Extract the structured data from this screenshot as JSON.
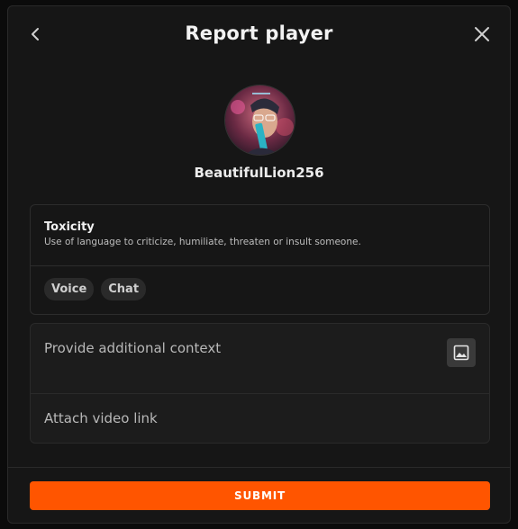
{
  "header": {
    "title": "Report player",
    "back_icon": "chevron-left-icon",
    "close_icon": "close-icon"
  },
  "player": {
    "username": "BeautifulLion256",
    "avatar": "avatar-image"
  },
  "reason": {
    "title": "Toxicity",
    "description": "Use of language to criticize, humiliate, threaten or insult someone.",
    "chips": [
      "Voice",
      "Chat"
    ]
  },
  "context": {
    "placeholder": "Provide additional context",
    "attach_icon": "image-icon",
    "video_placeholder": "Attach video link"
  },
  "footer": {
    "submit_label": "SUBMIT"
  },
  "colors": {
    "accent": "#ff5500",
    "background": "#161616"
  }
}
